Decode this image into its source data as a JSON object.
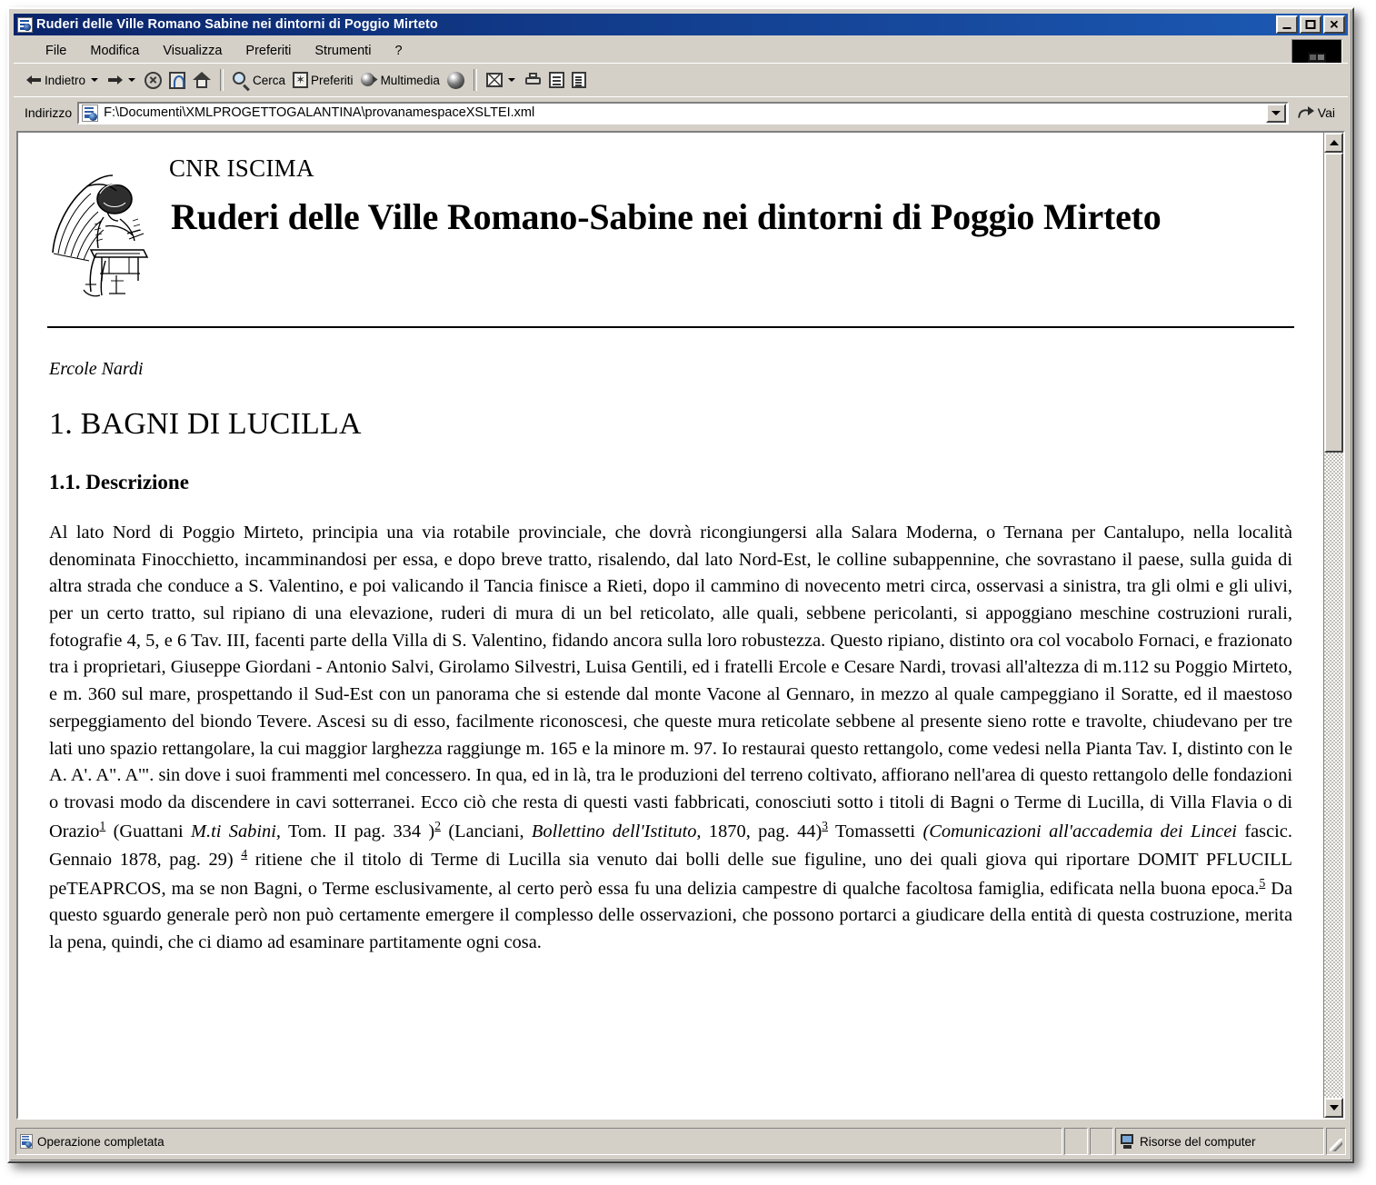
{
  "window": {
    "title": "Ruderi delle Ville Romano Sabine nei dintorni di Poggio Mirteto",
    "minimize_label": "",
    "maximize_label": "",
    "close_label": "✕"
  },
  "menu": {
    "items": [
      {
        "label": "File"
      },
      {
        "label": "Modifica"
      },
      {
        "label": "Visualizza"
      },
      {
        "label": "Preferiti"
      },
      {
        "label": "Strumenti"
      },
      {
        "label": "?"
      }
    ]
  },
  "toolbar": {
    "back_label": "Indietro",
    "forward_label": "",
    "stop_label": "",
    "refresh_label": "",
    "home_label": "",
    "search_label": "Cerca",
    "favorites_label": "Preferiti",
    "media_label": "Multimedia",
    "history_label": "",
    "mail_label": "",
    "print_label": "",
    "edit_label": "",
    "discuss_label": ""
  },
  "address": {
    "label": "Indirizzo",
    "url": "F:\\Documenti\\XMLPROGETTOGALANTINA\\provanamespaceXSLTEI.xml",
    "go_label": "Vai"
  },
  "document": {
    "organization": "CNR ISCIMA",
    "title": "Ruderi delle Ville Romano-Sabine nei dintorni di Poggio Mirteto",
    "author": "Ercole Nardi",
    "section_heading": "1. BAGNI DI LUCILLA",
    "subsection_heading": "1.1. Descrizione",
    "body": {
      "p1_a": "Al lato Nord di Poggio Mirteto, principia una via rotabile provinciale, che dovrà  ricongiungersi alla Salara Moderna, o Ternana per Cantalupo, nella località denominata Finocchietto, incamminandosi per essa, e dopo breve tratto, risalendo, dal lato Nord-Est, le colline subappennine, che sovrastano il paese, sulla guida di altra strada che conduce a S. Valentino, e poi valicando il Tancia finisce a Rieti, dopo il cammino di novecento metri circa, osservasi a sinistra, tra gli olmi e gli ulivi, per un certo tratto, sul ripiano di una elevazione, ruderi di mura di un bel reticolato, alle quali, sebbene pericolanti, si appoggiano meschine costruzioni rurali, fotografie 4, 5, e 6 Tav. III, facenti parte della Villa di S. Valentino, fidando ancora sulla loro robustezza. Questo ripiano, distinto ora col vocabolo Fornaci, e frazionato tra i proprietari, Giuseppe Giordani - Antonio Salvi, Girolamo Silvestri, Luisa Gentili, ed i fratelli Ercole e Cesare Nardi, trovasi all'altezza di m.112 su Poggio Mirteto, e m. 360 sul mare, prospettando il Sud-Est con un panorama che si estende dal monte Vacone al Gennaro, in mezzo al quale campeggiano il Soratte, ed il maestoso serpeggiamento del biondo Tevere. Ascesi su di esso, facilmente riconoscesi, che queste mura reticolate sebbene al presente sieno rotte e travolte, chiudevano per tre lati uno spazio rettangolare, la cui maggior larghezza raggiunge m. 165 e la minore m. 97. Io restaurai questo rettangolo, come vedesi nella Pianta Tav. I, distinto con le A. A'. A\". A'\". sin dove i suoi frammenti mel concessero. In qua, ed in là, tra le produzioni del terreno coltivato, affiorano nell'area di questo rettangolo delle fondazioni o trovasi modo da discendere in cavi sotterranei. Ecco ciò che resta di questi vasti fabbricati, conosciuti sotto i titoli di Bagni o Terme di Lucilla, di Villa Flavia o di Orazio",
      "fn1": "1",
      "p1_b": " (Guattani ",
      "p1_i1": "M.ti Sabini,",
      "p1_c": " Tom. II pag. 334 )",
      "fn2": "2",
      "p1_d": " (Lanciani, ",
      "p1_i2": "Bollettino dell'Istituto,",
      "p1_e": " 1870, pag. 44)",
      "fn3": "3",
      "p1_f": " Tomassetti ",
      "p1_i3": "(Comunicazioni all'accademia dei Lincei",
      "p1_g": " fascic. Gennaio 1878, pag. 29) ",
      "fn4": "4",
      "p1_h": " ritiene che il titolo di Terme di Lucilla sia venuto dai bolli delle sue figuline, uno dei quali giova qui riportare DOMIT PFLUCILL peTEAPRCOS, ma se non Bagni, o Terme esclusivamente, al certo però essa fu una delizia campestre di qualche facoltosa famiglia, edificata nella buona epoca.",
      "fn5": "5",
      "p1_i": " Da questo sguardo generale però non può certamente emergere il complesso delle osservazioni, che possono portarci a giudicare della entità  di questa costruzione, merita la pena, quindi, che ci diamo ad esaminare partitamente ogni cosa."
    }
  },
  "statusbar": {
    "message": "Operazione completata",
    "zone": "Risorse del computer"
  }
}
